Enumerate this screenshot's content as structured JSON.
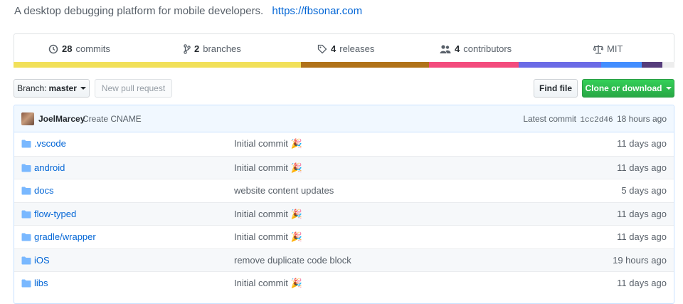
{
  "repo": {
    "description": "A desktop debugging platform for mobile developers.",
    "homepage": "https://fbsonar.com"
  },
  "summary": {
    "commits": {
      "count": "28",
      "label": "commits",
      "icon": "history-icon"
    },
    "branches": {
      "count": "2",
      "label": "branches",
      "icon": "branch-icon"
    },
    "releases": {
      "count": "4",
      "label": "releases",
      "icon": "tag-icon"
    },
    "contributors": {
      "count": "4",
      "label": "contributors",
      "icon": "people-icon"
    },
    "license": {
      "label": "MIT",
      "icon": "law-icon"
    }
  },
  "language_bar": [
    {
      "color": "#f1e05a",
      "share": 43.5
    },
    {
      "color": "#b07219",
      "share": 19.4
    },
    {
      "color": "#f34b7d",
      "share": 13.5
    },
    {
      "color": "#6b6be6",
      "share": 12.5
    },
    {
      "color": "#438eff",
      "share": 6.2
    },
    {
      "color": "#563d7c",
      "share": 3.1
    },
    {
      "color": "#ededed",
      "share": 1.8
    }
  ],
  "toolbar": {
    "branch_prefix": "Branch:",
    "branch_name": "master",
    "new_pull_request": "New pull request",
    "find_file": "Find file",
    "clone_download": "Clone or download"
  },
  "latest_commit": {
    "author": "JoelMarcey",
    "message": "Create CNAME",
    "prefix": "Latest commit",
    "sha": "1cc2d46",
    "time": "18 hours ago"
  },
  "files": [
    {
      "name": ".vscode",
      "message": "Initial commit",
      "emoji": "🎉",
      "age": "11 days ago"
    },
    {
      "name": "android",
      "message": "Initial commit",
      "emoji": "🎉",
      "age": "11 days ago"
    },
    {
      "name": "docs",
      "message": "website content updates",
      "emoji": "",
      "age": "5 days ago"
    },
    {
      "name": "flow-typed",
      "message": "Initial commit",
      "emoji": "🎉",
      "age": "11 days ago"
    },
    {
      "name": "gradle/wrapper",
      "message": "Initial commit",
      "emoji": "🎉",
      "age": "11 days ago"
    },
    {
      "name": "iOS",
      "message": "remove duplicate code block",
      "emoji": "",
      "age": "19 hours ago"
    },
    {
      "name": "libs",
      "message": "Initial commit",
      "emoji": "🎉",
      "age": "11 days ago"
    }
  ],
  "colors": {
    "link": "#0366d6",
    "primary_button": "#28a745",
    "folder_icon": "#79b8ff",
    "commit_row_bg": "#f1f8ff"
  }
}
